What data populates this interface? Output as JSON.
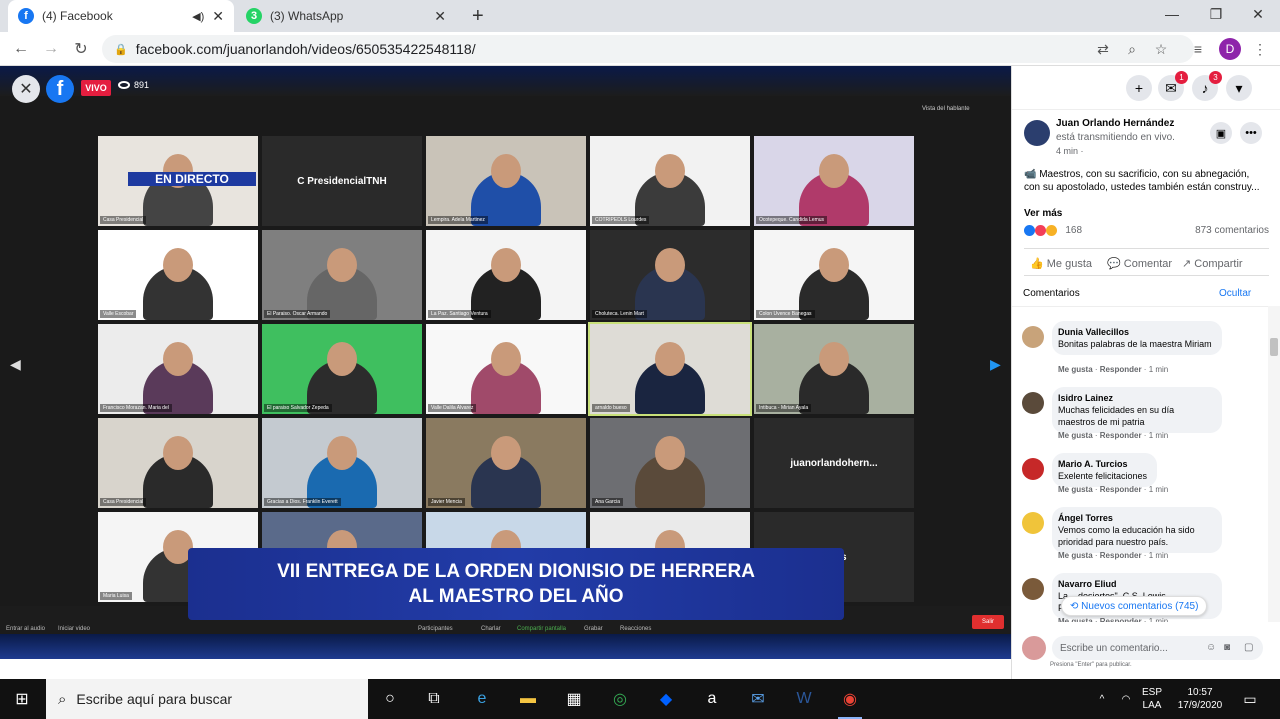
{
  "browser": {
    "tabs": [
      {
        "title": "(4) Facebook",
        "favicon_color": "#1877f2",
        "favicon_glyph": "f",
        "active": true
      },
      {
        "title": "(3) WhatsApp",
        "favicon_color": "#25d366",
        "favicon_glyph": "3",
        "active": false
      }
    ],
    "url": "facebook.com/juanorlandoh/videos/650535422548118/",
    "profile_initial": "D"
  },
  "video": {
    "live_label": "VIVO",
    "viewer_count": "891",
    "speaker_view_label": "Vista del hablante",
    "tiles": [
      {
        "name": "Casa Presidencial",
        "label": "EN DIRECTO",
        "type": "zoom-live"
      },
      {
        "name": "",
        "label": "C PresidencialTNH",
        "type": "text"
      },
      {
        "name": "Lempira. Adela Martinez",
        "label": "",
        "type": "person"
      },
      {
        "name": "COTRIPEDLS Lourdes",
        "label": "",
        "type": "person"
      },
      {
        "name": "Ocotepeque. Candida Lemus",
        "label": "",
        "type": "person"
      },
      {
        "name": "Valle Escobar",
        "label": "",
        "type": "person"
      },
      {
        "name": "El Paraiso. Oscar Armando",
        "label": "",
        "type": "person"
      },
      {
        "name": "La Paz. Santiago Ventura",
        "label": "",
        "type": "person"
      },
      {
        "name": "Choluteca. Lenin Mart",
        "label": "",
        "type": "person"
      },
      {
        "name": "Colon Uvence Banegas",
        "label": "",
        "type": "person"
      },
      {
        "name": "Francisco Morazan. Maria del",
        "label": "",
        "type": "person"
      },
      {
        "name": "El paraiso Salvador Zepeda",
        "label": "",
        "type": "person"
      },
      {
        "name": "Valle Dalila Alvarez",
        "label": "",
        "type": "person"
      },
      {
        "name": "arnaldo bueso",
        "label": "",
        "type": "person-highlight"
      },
      {
        "name": "Intibuca - Mirian Ayala",
        "label": "",
        "type": "person"
      },
      {
        "name": "Casa Presidencial",
        "label": "",
        "type": "person"
      },
      {
        "name": "Gracias a Dios. Franklin Everett",
        "label": "",
        "type": "person"
      },
      {
        "name": "Javier Mencia",
        "label": "",
        "type": "person"
      },
      {
        "name": "Ana Garcia",
        "label": "",
        "type": "person"
      },
      {
        "name": "",
        "label": "juanorlandohern...",
        "type": "text"
      },
      {
        "name": "Maria Luisa",
        "label": "",
        "type": "person"
      },
      {
        "name": "",
        "label": "",
        "type": "person"
      },
      {
        "name": "",
        "label": "",
        "type": "person"
      },
      {
        "name": "",
        "label": "",
        "type": "person"
      },
      {
        "name": "",
        "label": "...yes",
        "type": "text"
      }
    ],
    "banner_line1": "VII ENTREGA DE LA ORDEN DIONISIO DE HERRERA",
    "banner_line2": "AL MAESTRO DEL AÑO",
    "controls": {
      "audio": "Entrar al audio",
      "video": "Iniciar video",
      "participants": "Participantes",
      "chat": "Charlar",
      "share": "Compartir pantalla",
      "record": "Grabar",
      "reactions": "Reacciones",
      "leave": "Salir"
    }
  },
  "sidebar": {
    "messenger_badge": "1",
    "notifications_badge": "3",
    "post_author": "Juan Orlando Hernández",
    "post_status": "está transmitiendo en vivo.",
    "post_time": "4 min ·",
    "post_text": "📹 Maestros, con su sacrificio, con su abnegación, con su apostolado, ustedes también están construy...",
    "see_more": "Ver más",
    "reactions_count": "168",
    "comments_count": "873 comentarios",
    "like": "Me gusta",
    "comment": "Comentar",
    "share": "Compartir",
    "comments_header": "Comentarios",
    "hide": "Ocultar",
    "comments": [
      {
        "author": "Dunia Vallecillos",
        "text": "Bonitas palabras de la maestra Miriam",
        "time": "1 min",
        "avatar_color": "#c8a37a"
      },
      {
        "author": "Isidro Lainez",
        "text": "Muchas felicidades en su día maestros de mi patria",
        "time": "1 min",
        "avatar_color": "#5a4a3a"
      },
      {
        "author": "Mario A. Turcios",
        "text": "Exelente felicitaciones",
        "time": "1 min",
        "avatar_color": "#c62828"
      },
      {
        "author": "Ángel Torres",
        "text": "Vemos como la educación ha sido prioridad para nuestro país.",
        "time": "1 min",
        "avatar_color": "#f0c43a"
      },
      {
        "author": "Navarro Eliud",
        "text": "La... desiertos\". C.S. Lewis Felicidades",
        "time": "1 min",
        "avatar_color": "#7a5a3a"
      }
    ],
    "comment_like": "Me gusta",
    "comment_reply": "Responder",
    "new_comments": "Nuevos comentarios (745)",
    "write_placeholder": "Escribe un comentario...",
    "write_hint": "Presiona \"Enter\" para publicar."
  },
  "taskbar": {
    "search_placeholder": "Escribe aquí para buscar",
    "lang_top": "ESP",
    "lang_bottom": "LAA",
    "time": "10:57",
    "date": "17/9/2020"
  }
}
